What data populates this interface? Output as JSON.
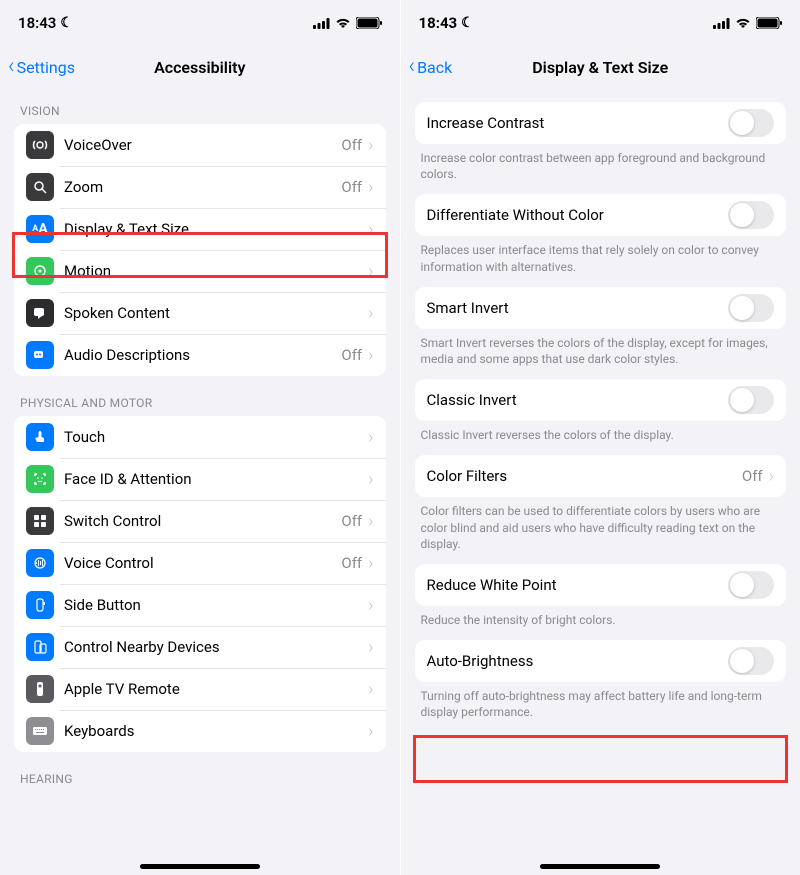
{
  "status": {
    "time": "18:43"
  },
  "left": {
    "back": "Settings",
    "title": "Accessibility",
    "vision_header": "VISION",
    "physical_header": "PHYSICAL AND MOTOR",
    "hearing_header": "HEARING",
    "rows": {
      "voiceover": {
        "label": "VoiceOver",
        "value": "Off"
      },
      "zoom": {
        "label": "Zoom",
        "value": "Off"
      },
      "display": {
        "label": "Display & Text Size",
        "value": ""
      },
      "motion": {
        "label": "Motion",
        "value": ""
      },
      "spoken": {
        "label": "Spoken Content",
        "value": ""
      },
      "audiodesc": {
        "label": "Audio Descriptions",
        "value": "Off"
      },
      "touch": {
        "label": "Touch",
        "value": ""
      },
      "faceid": {
        "label": "Face ID & Attention",
        "value": ""
      },
      "switch": {
        "label": "Switch Control",
        "value": "Off"
      },
      "voicectrl": {
        "label": "Voice Control",
        "value": "Off"
      },
      "sidebtn": {
        "label": "Side Button",
        "value": ""
      },
      "nearby": {
        "label": "Control Nearby Devices",
        "value": ""
      },
      "appletv": {
        "label": "Apple TV Remote",
        "value": ""
      },
      "keyboards": {
        "label": "Keyboards",
        "value": ""
      }
    }
  },
  "right": {
    "back": "Back",
    "title": "Display & Text Size",
    "rows": {
      "contrast": {
        "label": "Increase Contrast",
        "footer": "Increase color contrast between app foreground and background colors."
      },
      "diff": {
        "label": "Differentiate Without Color",
        "footer": "Replaces user interface items that rely solely on color to convey information with alternatives."
      },
      "smart": {
        "label": "Smart Invert",
        "footer": "Smart Invert reverses the colors of the display, except for images, media and some apps that use dark color styles."
      },
      "classic": {
        "label": "Classic Invert",
        "footer": "Classic Invert reverses the colors of the display."
      },
      "filters": {
        "label": "Color Filters",
        "value": "Off",
        "footer": "Color filters can be used to differentiate colors by users who are color blind and aid users who have difficulty reading text on the display."
      },
      "white": {
        "label": "Reduce White Point",
        "footer": "Reduce the intensity of bright colors."
      },
      "auto": {
        "label": "Auto-Brightness",
        "footer": "Turning off auto-brightness may affect battery life and long-term display performance."
      }
    }
  }
}
